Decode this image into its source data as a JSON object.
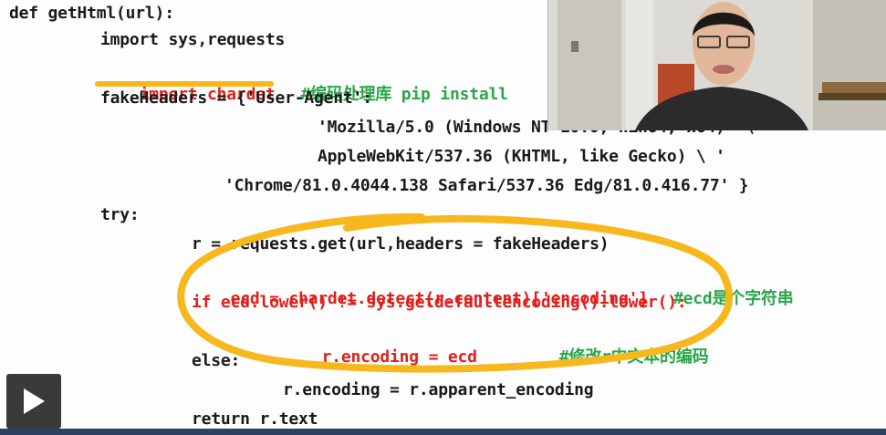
{
  "code": {
    "lines": [
      {
        "text": "def getHtml(url):"
      },
      {
        "text": "import sys,requests"
      },
      {
        "text": "import chardet",
        "comment": "#编码处理库 pip install"
      },
      {
        "text": "fakeHeaders = {'User-Agent':"
      },
      {
        "text": "'Mozilla/5.0 (Windows NT 10.0; Win64; x64)' \\"
      },
      {
        "text": "AppleWebKit/537.36 (KHTML, like Gecko) \\ '"
      },
      {
        "text": "'Chrome/81.0.4044.138 Safari/537.36 Edg/81.0.416.77' }"
      },
      {
        "text": "try:"
      },
      {
        "text": "r = requests.get(url,headers = fakeHeaders)"
      },
      {
        "text": "ecd = chardet.detect(r.content)['encoding']",
        "comment": "#ecd是个字符串"
      },
      {
        "text": "if ecd.lower() != sys.getdefaultencoding().lower():"
      },
      {
        "text": "r.encoding = ecd",
        "comment": "#修改r中文本的编码"
      },
      {
        "text": "else:"
      },
      {
        "text": "r.encoding = r.apparent_encoding"
      },
      {
        "text": "return r.text"
      }
    ]
  },
  "annotations": {
    "highlight_color": "#f6b81c",
    "code_red": "#e0201c",
    "comment_green": "#2aa64a"
  },
  "player": {
    "play_icon": "play-icon"
  }
}
